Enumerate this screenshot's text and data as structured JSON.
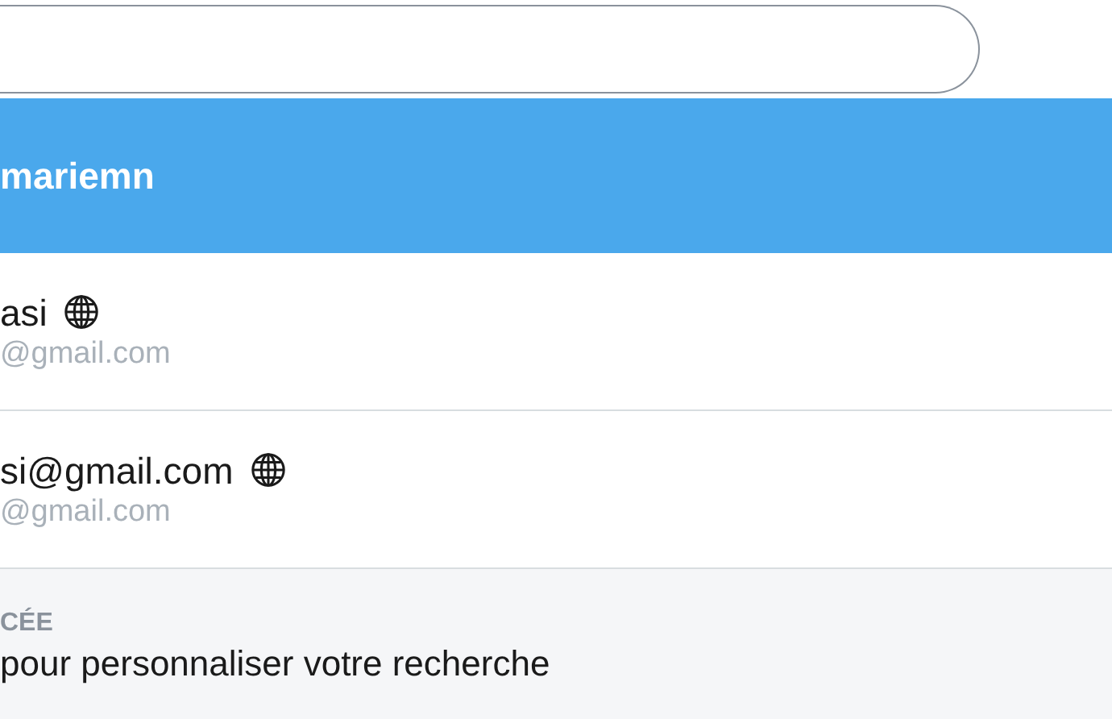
{
  "results": [
    {
      "name": "mariemn",
      "public": false,
      "selected": true
    },
    {
      "name": "asi",
      "email": "@gmail.com",
      "public": true,
      "selected": false
    },
    {
      "name": "si@gmail.com",
      "email": "@gmail.com",
      "public": true,
      "selected": false
    }
  ],
  "footer": {
    "heading": "CÉE",
    "text": "pour personnaliser votre recherche"
  }
}
